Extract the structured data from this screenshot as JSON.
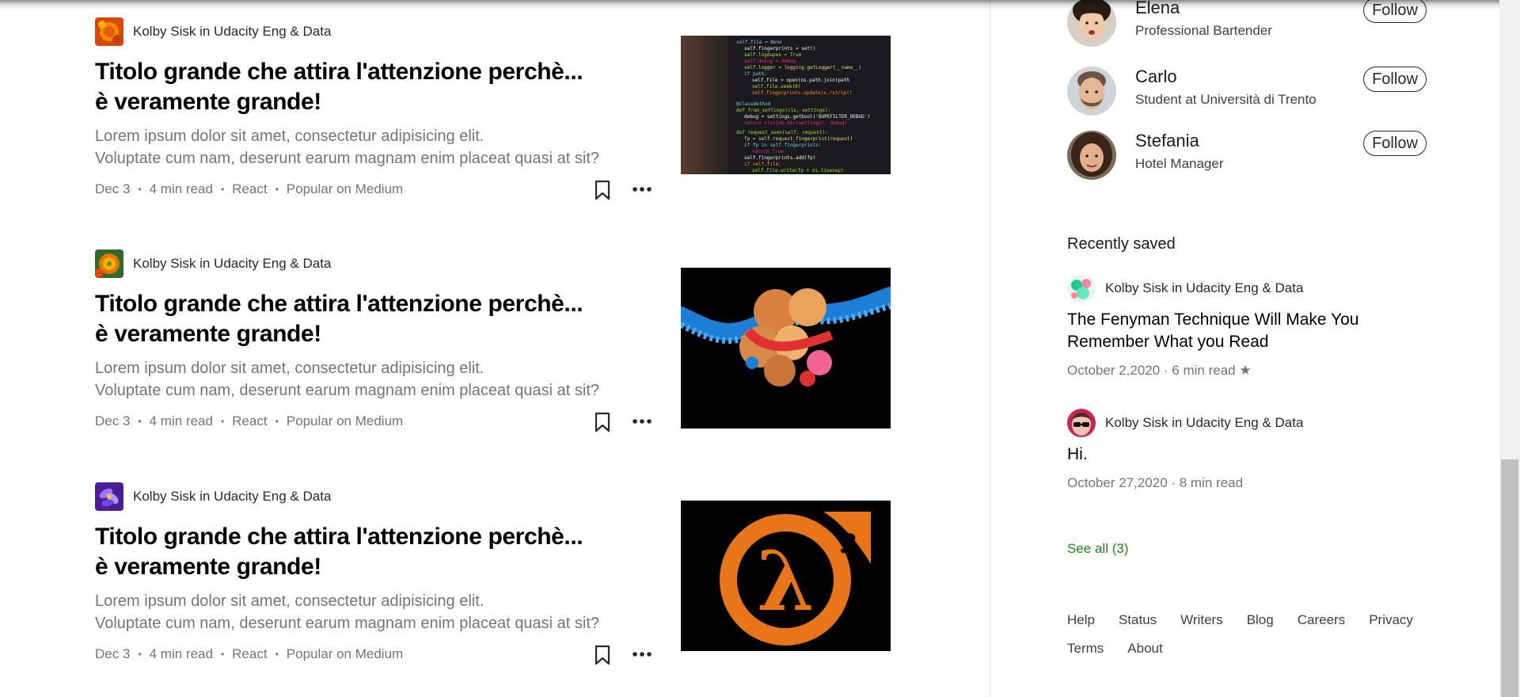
{
  "articles": [
    {
      "author": "Kolby Sisk in Udacity Eng & Data",
      "title_line1": "Titolo grande che attira l'attenzione perchè...",
      "title_line2": "è veramente grande!",
      "excerpt_line1": "Lorem ipsum dolor sit amet, consectetur adipisicing elit.",
      "excerpt_line2": "Voluptate cum nam, deserunt earum magnam enim placeat quasi at sit?",
      "date": "Dec 3",
      "read_time": "4 min read",
      "tag": "React",
      "popular": "Popular on Medium",
      "bookmark_icon": "bookmark-icon",
      "more_icon": "more-icon"
    },
    {
      "author": "Kolby Sisk in Udacity Eng & Data",
      "title_line1": "Titolo grande che attira l'attenzione perchè...",
      "title_line2": "è veramente grande!",
      "excerpt_line1": "Lorem ipsum dolor sit amet, consectetur adipisicing elit.",
      "excerpt_line2": "Voluptate cum nam, deserunt earum magnam enim placeat quasi at sit?",
      "date": "Dec 3",
      "read_time": "4 min read",
      "tag": "React",
      "popular": "Popular on Medium",
      "bookmark_icon": "bookmark-icon",
      "more_icon": "more-icon"
    },
    {
      "author": "Kolby Sisk in Udacity Eng & Data",
      "title_line1": "Titolo grande che attira l'attenzione perchè...",
      "title_line2": "è veramente grande!",
      "excerpt_line1": "Lorem ipsum dolor sit amet, consectetur adipisicing elit.",
      "excerpt_line2": "Voluptate cum nam, deserunt earum magnam enim placeat quasi at sit?",
      "date": "Dec 3",
      "read_time": "4 min read",
      "tag": "React",
      "popular": "Popular on Medium",
      "bookmark_icon": "bookmark-icon",
      "more_icon": "more-icon"
    }
  ],
  "who_to_follow": [
    {
      "name": "Elena",
      "bio": "Professional Bartender",
      "button": "Follow"
    },
    {
      "name": "Carlo",
      "bio": "Student at Università di Trento",
      "button": "Follow"
    },
    {
      "name": "Stefania",
      "bio": "Hotel Manager",
      "button": "Follow"
    }
  ],
  "recently_saved": {
    "heading": "Recently saved",
    "items": [
      {
        "author": "Kolby Sisk in Udacity Eng & Data",
        "title": "The Fenyman Technique Will Make You Remember What you Read",
        "meta": "October 2,2020 · 6 min read ★"
      },
      {
        "author": "Kolby Sisk in Udacity Eng & Data",
        "title": "Hi.",
        "meta": "October 27,2020 · 8 min read"
      }
    ],
    "see_all": "See all (3)"
  },
  "footer": {
    "links": [
      "Help",
      "Status",
      "Writers",
      "Blog",
      "Careers",
      "Privacy",
      "Terms",
      "About"
    ]
  },
  "colors": {
    "accent_green": "#1a8917",
    "meta_gray": "#757575",
    "hl3_orange": "#e8751a"
  }
}
